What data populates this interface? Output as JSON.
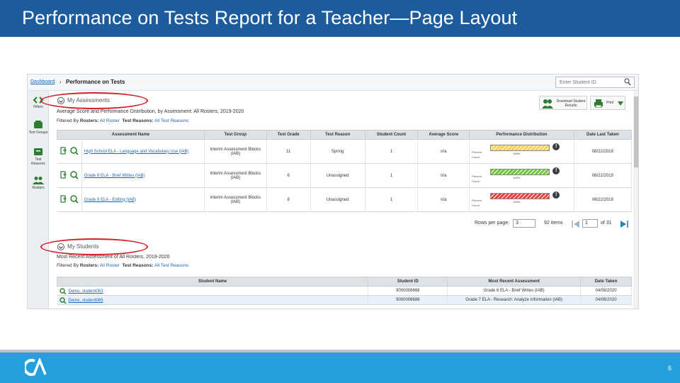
{
  "slide": {
    "title": "Performance on Tests Report for a Teacher—Page Layout",
    "page_number": "6",
    "logo_text": "CA"
  },
  "app": {
    "breadcrumb": {
      "link": "Dashboard",
      "separator": "›",
      "current": "Performance on Tests"
    },
    "search_placeholder": "Enter Student ID",
    "sidebar": [
      {
        "label": "Filters",
        "icon": "filter-icon"
      },
      {
        "label": "Test Groups",
        "icon": "test-groups-icon"
      },
      {
        "label": "Test Reasons",
        "icon": "test-reasons-icon"
      },
      {
        "label": "Rosters",
        "icon": "rosters-icon"
      }
    ],
    "toolbar": {
      "download_label": "Download Student Results",
      "print_label": "Print"
    },
    "assessments": {
      "heading": "My Assessments",
      "subtitle": "Average Score and Performance Distribution, by Assessment: All Rosters, 2019-2020",
      "filter_prefix": "Filtered By",
      "filter_rosters_label": "Rosters:",
      "filter_rosters_value": "All Roster",
      "filter_reasons_label": "Test Reasons:",
      "filter_reasons_value": "All Test Reasons",
      "columns": [
        "Assessment Name",
        "Test Group",
        "Test Grade",
        "Test Reason",
        "Student Count",
        "Average Score",
        "Performance Distribution",
        "Date Last Taken"
      ],
      "rows": [
        {
          "name": "High School ELA - Language and Vocabulary Use (IAB)",
          "group": "Interim Assessment Blocks (IAB)",
          "grade": "11",
          "reason": "Spring",
          "count": "1",
          "avg": "n/a",
          "percent": "100%",
          "bar_color": "#f2cf55",
          "date": "08/22/2019"
        },
        {
          "name": "Grade 6 ELA - Brief Writes (IAB)",
          "group": "Interim Assessment Blocks (IAB)",
          "grade": "6",
          "reason": "Unassigned",
          "count": "1",
          "avg": "n/a",
          "percent": "100%",
          "bar_color": "#6fc43c",
          "date": "08/22/2019"
        },
        {
          "name": "Grade 6 ELA - Editing (IAB)",
          "group": "Interim Assessment Blocks (IAB)",
          "grade": "6",
          "reason": "Unassigned",
          "count": "1",
          "avg": "n/a",
          "percent": "100%",
          "bar_color": "#e2433b",
          "date": "08/22/2019"
        }
      ],
      "bar_labels": {
        "percent": "Percent",
        "count": "Count"
      },
      "pager": {
        "rows_label": "Rows per page:",
        "rows_value": "3",
        "items": "92 items",
        "page": "1",
        "of": "of 31"
      }
    },
    "students": {
      "heading": "My Students",
      "subtitle": "Most Recent Assessment of All Rosters, 2019-2020",
      "filter_prefix": "Filtered By",
      "filter_rosters_label": "Rosters:",
      "filter_rosters_value": "All Roster",
      "filter_reasons_label": "Test Reasons:",
      "filter_reasons_value": "All Test Reasons",
      "columns": [
        "Student Name",
        "Student ID",
        "Most Recent Assessment",
        "Date Taken"
      ],
      "rows": [
        {
          "name": "Demo, student063",
          "id": "9000006668",
          "assessment": "Grade 6 ELA - Brief Writes (IAB)",
          "date": "04/08/2020"
        },
        {
          "name": "Demo, student065",
          "id": "9000006686",
          "assessment": "Grade 7 ELA - Research: Analyze Information (IAB)",
          "date": "04/08/2020"
        }
      ]
    }
  }
}
